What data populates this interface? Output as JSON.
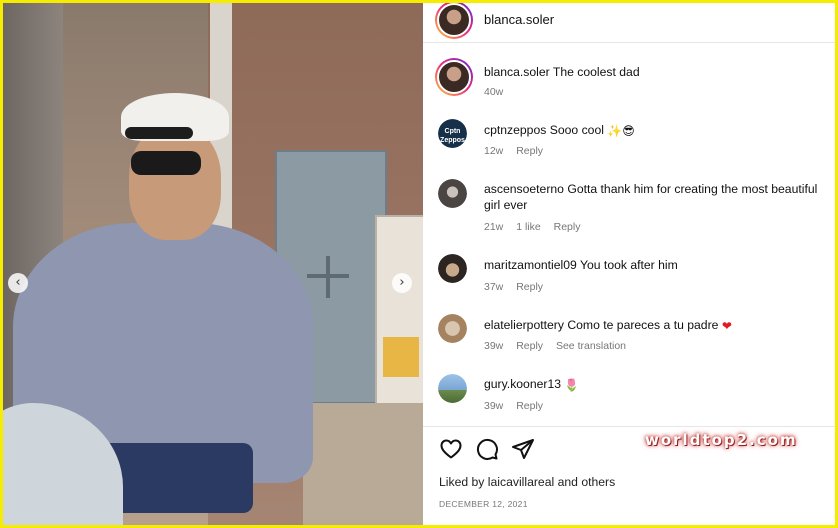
{
  "post": {
    "author": "blanca.soler",
    "caption_user": "blanca.soler",
    "caption_text": "The coolest dad",
    "caption_age": "40w"
  },
  "photo": {
    "prev_icon": "chevron-left-icon",
    "next_icon": "chevron-right-icon",
    "prev_glyph": "‹",
    "next_glyph": "›"
  },
  "comments": [
    {
      "user": "cptnzeppos",
      "text": "Sooo cool",
      "emojis": "✨😎",
      "age": "12w",
      "likes": "",
      "reply": "Reply",
      "translate": "",
      "avatar_text": "Cptn Zeppos"
    },
    {
      "user": "ascensoeterno",
      "text": "Gotta thank him for creating the most beautiful girl ever",
      "emojis": "",
      "age": "21w",
      "likes": "1 like",
      "reply": "Reply",
      "translate": ""
    },
    {
      "user": "maritzamontiel09",
      "text": "You took after him",
      "emojis": "",
      "age": "37w",
      "likes": "",
      "reply": "Reply",
      "translate": ""
    },
    {
      "user": "elatelierpottery",
      "text": "Como te pareces a tu padre",
      "emojis": "❤",
      "age": "39w",
      "likes": "",
      "reply": "Reply",
      "translate": "See translation"
    },
    {
      "user": "gury.kooner13",
      "text": "",
      "emojis": "🌷",
      "age": "39w",
      "likes": "",
      "reply": "Reply",
      "translate": ""
    }
  ],
  "actions": {
    "like_icon": "heart-outline-icon",
    "comment_icon": "comment-bubble-icon",
    "share_icon": "send-paper-plane-icon"
  },
  "likes": {
    "prefix": "Liked by",
    "user": "laicavillareal",
    "and": "and",
    "others": "others"
  },
  "date": "DECEMBER 12, 2021",
  "watermark": "worldtop2.com",
  "colors": {
    "border": "#f5ec00",
    "heart": "#e01b24",
    "muted": "#777777"
  }
}
